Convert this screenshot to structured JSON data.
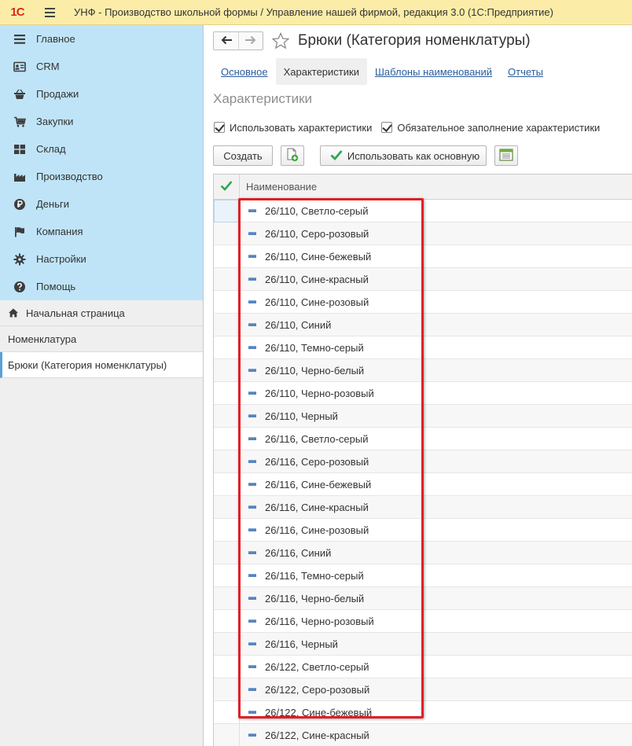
{
  "titlebar": {
    "logo": "1С",
    "title": "УНФ - Производство школьной формы / Управление нашей фирмой, редакция 3.0  (1С:Предприятие)"
  },
  "sidebar": {
    "menu": [
      {
        "label": "Главное",
        "icon": "list-icon"
      },
      {
        "label": "CRM",
        "icon": "contact-card-icon"
      },
      {
        "label": "Продажи",
        "icon": "shopping-basket-icon"
      },
      {
        "label": "Закупки",
        "icon": "cart-icon"
      },
      {
        "label": "Склад",
        "icon": "warehouse-grid-icon"
      },
      {
        "label": "Производство",
        "icon": "factory-icon"
      },
      {
        "label": "Деньги",
        "icon": "ruble-coin-icon"
      },
      {
        "label": "Компания",
        "icon": "flag-icon"
      },
      {
        "label": "Настройки",
        "icon": "gear-icon"
      },
      {
        "label": "Помощь",
        "icon": "help-icon"
      }
    ],
    "nav": {
      "home": "Начальная страница",
      "nomenclature": "Номенклатура",
      "current": "Брюки (Категория номенклатуры)"
    }
  },
  "main": {
    "title": "Брюки (Категория номенклатуры)",
    "tabs": [
      {
        "label": "Основное"
      },
      {
        "label": "Характеристики"
      },
      {
        "label": "Шаблоны наименований"
      },
      {
        "label": "Отчеты"
      }
    ],
    "section_title": "Характеристики",
    "checkboxes": {
      "use": "Использовать характеристики",
      "required": "Обязательное заполнение характеристики"
    },
    "toolbar": {
      "create": "Создать",
      "use_as_main": "Использовать как основную"
    },
    "grid": {
      "column": "Наименование",
      "rows": [
        "26/110, Светло-серый",
        "26/110, Серо-розовый",
        "26/110, Сине-бежевый",
        "26/110, Сине-красный",
        "26/110, Сине-розовый",
        "26/110, Синий",
        "26/110, Темно-серый",
        "26/110, Черно-белый",
        "26/110, Черно-розовый",
        "26/110, Черный",
        "26/116, Светло-серый",
        "26/116, Серо-розовый",
        "26/116, Сине-бежевый",
        "26/116, Сине-красный",
        "26/116, Сине-розовый",
        "26/116, Синий",
        "26/116, Темно-серый",
        "26/116, Черно-белый",
        "26/116, Черно-розовый",
        "26/116, Черный",
        "26/122, Светло-серый",
        "26/122, Серо-розовый",
        "26/122, Сине-бежевый",
        "26/122, Сине-красный"
      ]
    }
  },
  "colors": {
    "titlebar": "#fbeda8",
    "sidebar_menu": "#bfe4f8",
    "link": "#2a5d9c",
    "highlight": "#e01f26"
  }
}
